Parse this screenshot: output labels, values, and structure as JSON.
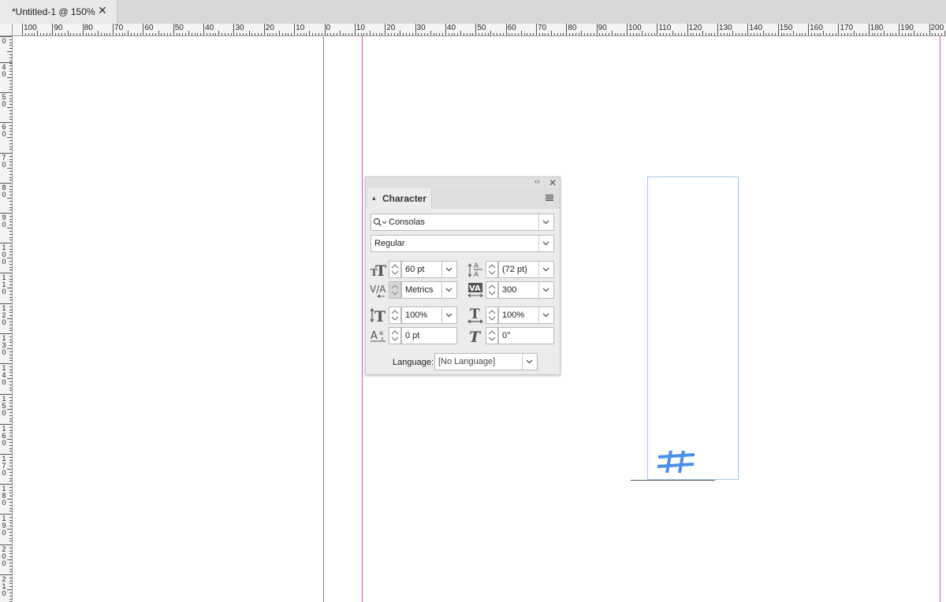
{
  "document_tab": {
    "title": "*Untitled-1 @ 150%",
    "close_glyph": "✕"
  },
  "rulers": {
    "horizontal_labels": [
      "100",
      "90",
      "80",
      "70",
      "60",
      "50",
      "40",
      "30",
      "20",
      "10",
      "0",
      "10",
      "20",
      "30",
      "40",
      "50",
      "60",
      "70",
      "80",
      "90",
      "100",
      "110",
      "120",
      "130",
      "140",
      "150",
      "160",
      "170",
      "180",
      "190",
      "200"
    ],
    "vertical_labels": [
      "0",
      "40",
      "50",
      "60",
      "70",
      "80",
      "90",
      "100",
      "110",
      "120",
      "130",
      "140",
      "150",
      "160",
      "170",
      "180",
      "190",
      "200",
      "210"
    ]
  },
  "character_panel": {
    "title": "Character",
    "collapse_glyph": "‹‹",
    "close_glyph": "✕",
    "font_family": "Consolas",
    "font_style": "Regular",
    "font_size": "60 pt",
    "leading": "(72 pt)",
    "kerning": "Metrics",
    "tracking": "300",
    "vertical_scale": "100%",
    "horizontal_scale": "100%",
    "baseline_shift": "0 pt",
    "skew": "0°",
    "language_label": "Language:",
    "language_value": "[No Language]"
  },
  "canvas": {
    "frame_glyph": "#",
    "glyph_color": "#4a8fe8",
    "frame_color": "#a7c9ee",
    "margin_guide_color": "#c94fc9"
  }
}
